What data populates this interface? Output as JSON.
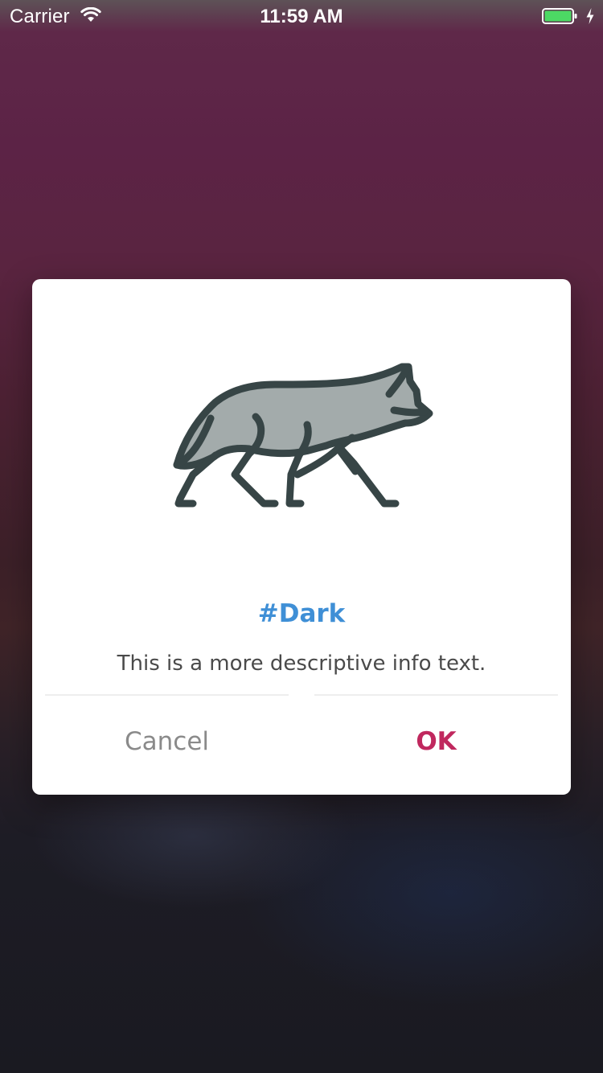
{
  "status_bar": {
    "carrier": "Carrier",
    "time": "11:59 AM",
    "battery_color": "#4cd964"
  },
  "dialog": {
    "image_icon": "wolf-icon",
    "title": "#Dark",
    "message": "This is a more descriptive info text.",
    "cancel_label": "Cancel",
    "ok_label": "OK"
  },
  "colors": {
    "title": "#3f8fd6",
    "ok_button": "#c0285e",
    "cancel_button": "#8a8a8a",
    "wolf_fill": "#a3abab",
    "wolf_stroke": "#374546"
  }
}
